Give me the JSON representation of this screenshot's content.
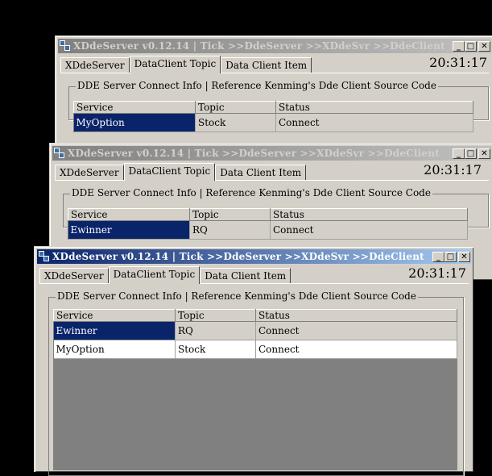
{
  "window_title": "XDdeServer v0.12.14 | Tick >>DdeServer >>XDdeSvr >>DdeClient",
  "buttons": {
    "minimize": "_",
    "maximize": "□",
    "close": "✕"
  },
  "tabs": [
    "XDdeServer",
    "DataClient Topic",
    "Data Client Item"
  ],
  "clock": "20:31:17",
  "group_label": "DDE Server Connect Info | Reference Kenming's Dde Client Source Code",
  "columns": [
    "Service",
    "Topic",
    "Status"
  ],
  "windows": [
    {
      "rows": [
        {
          "service": "MyOption",
          "topic": "Stock",
          "status": "Connect"
        }
      ]
    },
    {
      "rows": [
        {
          "service": "Ewinner",
          "topic": "RQ",
          "status": "Connect"
        }
      ]
    },
    {
      "rows": [
        {
          "service": "Ewinner",
          "topic": "RQ",
          "status": "Connect"
        },
        {
          "service": "MyOption",
          "topic": "Stock",
          "status": "Connect"
        }
      ]
    }
  ]
}
